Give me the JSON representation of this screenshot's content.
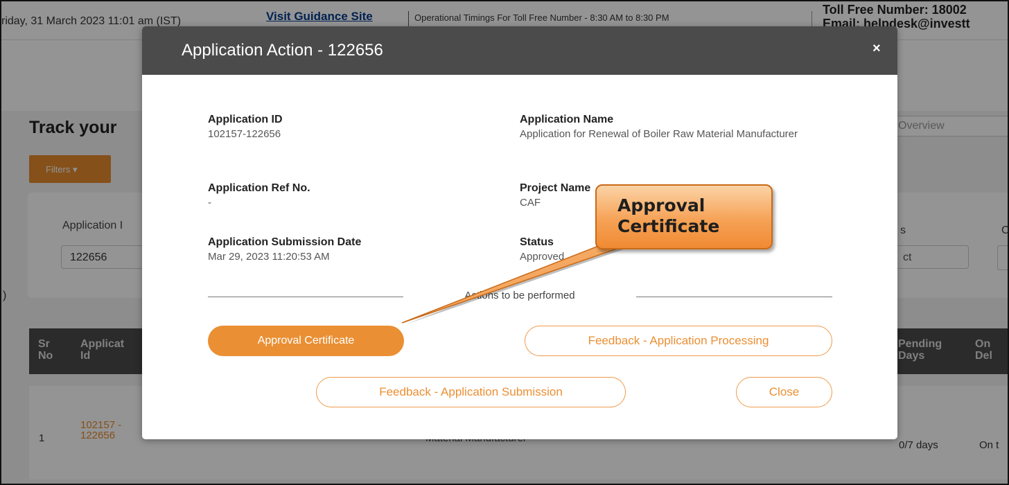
{
  "topbar": {
    "date": "riday, 31 March 2023 11:01 am (IST)",
    "guidance_link": "Visit Guidance Site",
    "timings": "Operational Timings For Toll Free Number - 8:30 AM to 8:30 PM",
    "toll_free": "Toll Free Number: 18002",
    "email": "Email: helpdesk@investt"
  },
  "page": {
    "title": "Track your",
    "overview_tab": "Overview",
    "filters_label": "Filters",
    "application_label": "Application I",
    "application_input_value": "122656",
    "right_label_s": "s",
    "right_select_value": "ct",
    "right_edge_label": "C",
    "left_paren": ")"
  },
  "table": {
    "headers": {
      "sr": "Sr No",
      "app_id": "Applicat Id",
      "pending": "Pending Days",
      "on": "On Del"
    },
    "row": {
      "sr": "1",
      "app_id": "102157 - 122656",
      "name_fragment": "Material Manufacturer",
      "days": "0/7 days",
      "on": "On t"
    }
  },
  "modal": {
    "title": "Application Action - 122656",
    "close_symbol": "×",
    "fields": {
      "app_id_label": "Application ID",
      "app_id_value": "102157-122656",
      "app_name_label": "Application Name",
      "app_name_value": "Application for Renewal of Boiler Raw Material Manufacturer",
      "ref_label": "Application Ref No.",
      "ref_value": "-",
      "project_label": "Project Name",
      "project_value": "CAF",
      "submission_label": "Application Submission Date",
      "submission_value": "Mar 29, 2023 11:20:53 AM",
      "status_label": "Status",
      "status_value": "Approved"
    },
    "actions_heading": "Actions to be performed",
    "buttons": {
      "approval_certificate": "Approval Certificate",
      "feedback_processing": "Feedback - Application Processing",
      "feedback_submission": "Feedback - Application Submission",
      "close": "Close"
    }
  },
  "callout": {
    "text_line1": "Approval",
    "text_line2": "Certificate"
  },
  "colors": {
    "accent": "#ea8f33",
    "header_bg": "#4b4b4b",
    "link": "#003a8c"
  }
}
